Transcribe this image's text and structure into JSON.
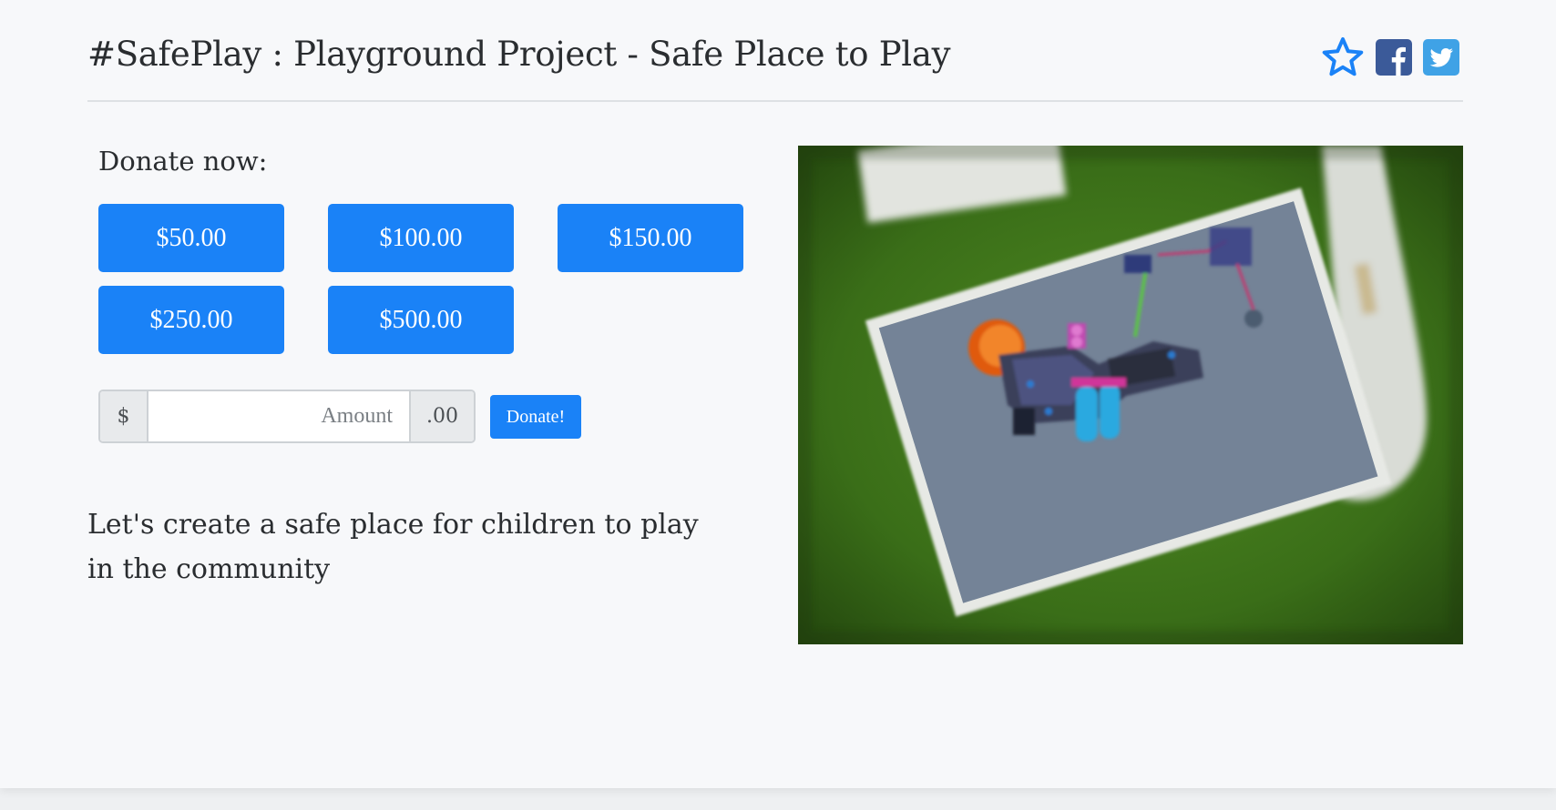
{
  "header": {
    "title": "#SafePlay : Playground Project - Safe Place to Play",
    "share_icons": [
      "star-outline-icon",
      "facebook-icon",
      "twitter-icon"
    ]
  },
  "donate": {
    "label": "Donate now:",
    "preset_amounts": [
      "$50.00",
      "$100.00",
      "$150.00",
      "$250.00",
      "$500.00"
    ],
    "currency_prefix": "$",
    "amount_placeholder": "Amount",
    "amount_value": "",
    "cents_suffix": ".00",
    "submit_label": "Donate!"
  },
  "description": "Let's create a safe place for children to play in the community",
  "colors": {
    "accent": "#1a82f7",
    "facebook": "#3b5a99",
    "twitter": "#3fa2e6",
    "star": "#1a82f7"
  }
}
